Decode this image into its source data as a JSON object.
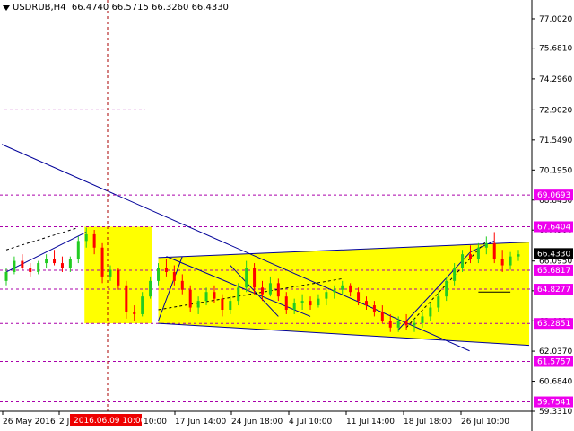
{
  "header": {
    "symbol": "USDRUB,H4",
    "open": "66.4740",
    "high": "66.5715",
    "low": "66.3260",
    "close": "66.4330"
  },
  "colors": {
    "background": "#ffffff",
    "zone_fill": "#ffff00",
    "bull_candle": "#22cc22",
    "bear_candle": "#ff0000",
    "level_line": "#aa00aa",
    "trend_line": "#000099",
    "crosshair": "#aa0000",
    "level_label_bg": "#ee00ee",
    "current_label_bg": "#000000",
    "time_highlight_bg": "#ee0000"
  },
  "chart_data": {
    "type": "candlestick",
    "y_axis_ticks": [
      "77.0020",
      "75.6810",
      "74.2960",
      "72.9020",
      "71.5490",
      "70.1950",
      "68.8430",
      "67.4900",
      "66.0950",
      "64.7550",
      "63.4010",
      "62.0370",
      "60.6840",
      "59.3310"
    ],
    "y_range": [
      59.331,
      77.85
    ],
    "x_axis_labels": [
      "26 May 2016",
      "2 Jun 2016",
      "9 Jun 10:00",
      "17 Jun 14:00",
      "24 Jun 18:00",
      "4 Jul 10:00",
      "11 Jul 14:00",
      "18 Jul 18:00",
      "26 Jul 10:00"
    ],
    "crosshair_time_label": "2016.06.09 10:00",
    "current_price": "66.4330",
    "levels": [
      {
        "value": "72.9020",
        "label": ""
      },
      {
        "value": "69.0693",
        "label": "69.0693"
      },
      {
        "value": "67.6404",
        "label": "67.6404"
      },
      {
        "value": "65.6817",
        "label": "65.6817"
      },
      {
        "value": "64.8277",
        "label": "64.8277"
      },
      {
        "value": "63.2851",
        "label": "63.2851"
      },
      {
        "value": "61.5757",
        "label": "61.5757"
      },
      {
        "value": "59.7541",
        "label": "59.7541"
      }
    ],
    "candles": [
      [
        65.2,
        65.8,
        65.0,
        65.6
      ],
      [
        65.6,
        66.3,
        65.5,
        66.1
      ],
      [
        66.1,
        66.4,
        65.7,
        65.8
      ],
      [
        65.8,
        66.0,
        65.4,
        65.6
      ],
      [
        65.6,
        66.1,
        65.5,
        66.0
      ],
      [
        66.0,
        66.4,
        65.8,
        66.2
      ],
      [
        66.2,
        66.6,
        65.9,
        66.0
      ],
      [
        66.0,
        66.3,
        65.6,
        65.8
      ],
      [
        65.8,
        66.3,
        65.6,
        66.2
      ],
      [
        66.2,
        67.2,
        66.0,
        67.0
      ],
      [
        67.0,
        67.6,
        66.7,
        67.3
      ],
      [
        67.3,
        67.5,
        66.4,
        66.7
      ],
      [
        66.7,
        66.9,
        65.1,
        65.4
      ],
      [
        65.4,
        65.9,
        65.2,
        65.7
      ],
      [
        65.7,
        65.8,
        64.8,
        65.0
      ],
      [
        65.0,
        65.2,
        63.5,
        63.8
      ],
      [
        63.8,
        64.1,
        63.4,
        63.7
      ],
      [
        63.7,
        64.7,
        63.6,
        64.5
      ],
      [
        64.5,
        65.4,
        64.4,
        65.2
      ],
      [
        65.2,
        66.0,
        65.0,
        65.8
      ],
      [
        65.8,
        66.2,
        65.4,
        65.6
      ],
      [
        65.6,
        65.9,
        65.0,
        65.2
      ],
      [
        65.2,
        65.5,
        64.6,
        64.8
      ],
      [
        64.8,
        65.0,
        63.8,
        64.0
      ],
      [
        64.0,
        64.5,
        63.7,
        64.3
      ],
      [
        64.3,
        64.9,
        64.1,
        64.7
      ],
      [
        64.7,
        65.0,
        64.2,
        64.4
      ],
      [
        64.4,
        64.6,
        63.6,
        63.9
      ],
      [
        63.9,
        64.5,
        63.7,
        64.3
      ],
      [
        64.3,
        65.1,
        64.1,
        64.9
      ],
      [
        64.9,
        66.1,
        64.7,
        65.8
      ],
      [
        65.8,
        66.0,
        64.6,
        64.9
      ],
      [
        64.9,
        65.2,
        64.3,
        64.6
      ],
      [
        64.6,
        65.4,
        64.5,
        65.1
      ],
      [
        65.1,
        65.3,
        64.3,
        64.5
      ],
      [
        64.5,
        64.7,
        63.7,
        63.9
      ],
      [
        63.9,
        64.4,
        63.7,
        64.2
      ],
      [
        64.2,
        64.6,
        63.9,
        64.3
      ],
      [
        64.3,
        64.5,
        63.9,
        64.1
      ],
      [
        64.1,
        64.6,
        64.0,
        64.4
      ],
      [
        64.4,
        64.8,
        64.1,
        64.7
      ],
      [
        64.7,
        65.0,
        64.4,
        64.8
      ],
      [
        64.8,
        65.2,
        64.6,
        65.0
      ],
      [
        65.0,
        65.1,
        64.5,
        64.7
      ],
      [
        64.7,
        64.9,
        64.1,
        64.3
      ],
      [
        64.3,
        64.5,
        63.9,
        64.1
      ],
      [
        64.1,
        64.3,
        63.6,
        63.8
      ],
      [
        63.8,
        64.1,
        63.3,
        63.4
      ],
      [
        63.4,
        63.7,
        62.9,
        63.1
      ],
      [
        63.1,
        63.6,
        62.9,
        63.4
      ],
      [
        63.4,
        63.7,
        63.0,
        63.2
      ],
      [
        63.2,
        63.5,
        62.9,
        63.3
      ],
      [
        63.3,
        63.8,
        63.1,
        63.6
      ],
      [
        63.6,
        64.2,
        63.4,
        64.0
      ],
      [
        64.0,
        64.7,
        63.8,
        64.5
      ],
      [
        64.5,
        65.4,
        64.3,
        65.2
      ],
      [
        65.2,
        66.0,
        65.0,
        65.8
      ],
      [
        65.8,
        66.6,
        65.6,
        66.4
      ],
      [
        66.4,
        66.8,
        66.0,
        66.2
      ],
      [
        66.2,
        66.9,
        66.0,
        66.7
      ],
      [
        66.7,
        67.2,
        66.4,
        66.9
      ],
      [
        66.9,
        67.4,
        66.0,
        66.2
      ],
      [
        66.2,
        66.6,
        65.6,
        65.9
      ],
      [
        65.9,
        66.5,
        65.7,
        66.3
      ],
      [
        66.3,
        66.6,
        66.1,
        66.4
      ]
    ]
  }
}
